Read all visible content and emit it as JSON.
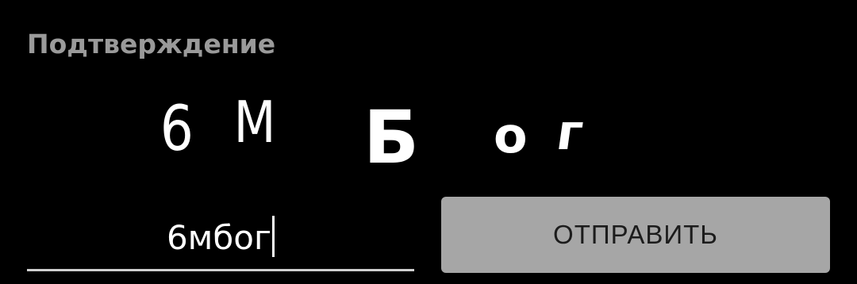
{
  "confirmation": {
    "label": "Подтверждение",
    "captcha_chars": [
      "6",
      "M",
      "Б",
      "о",
      "г"
    ]
  },
  "answer": {
    "value": "6мбог"
  },
  "submit": {
    "label": "ОТПРАВИТЬ"
  },
  "colors": {
    "background": "#000000",
    "label": "#9a9a9a",
    "button_bg": "#a6a6a6",
    "underline": "#cfcfcf"
  }
}
